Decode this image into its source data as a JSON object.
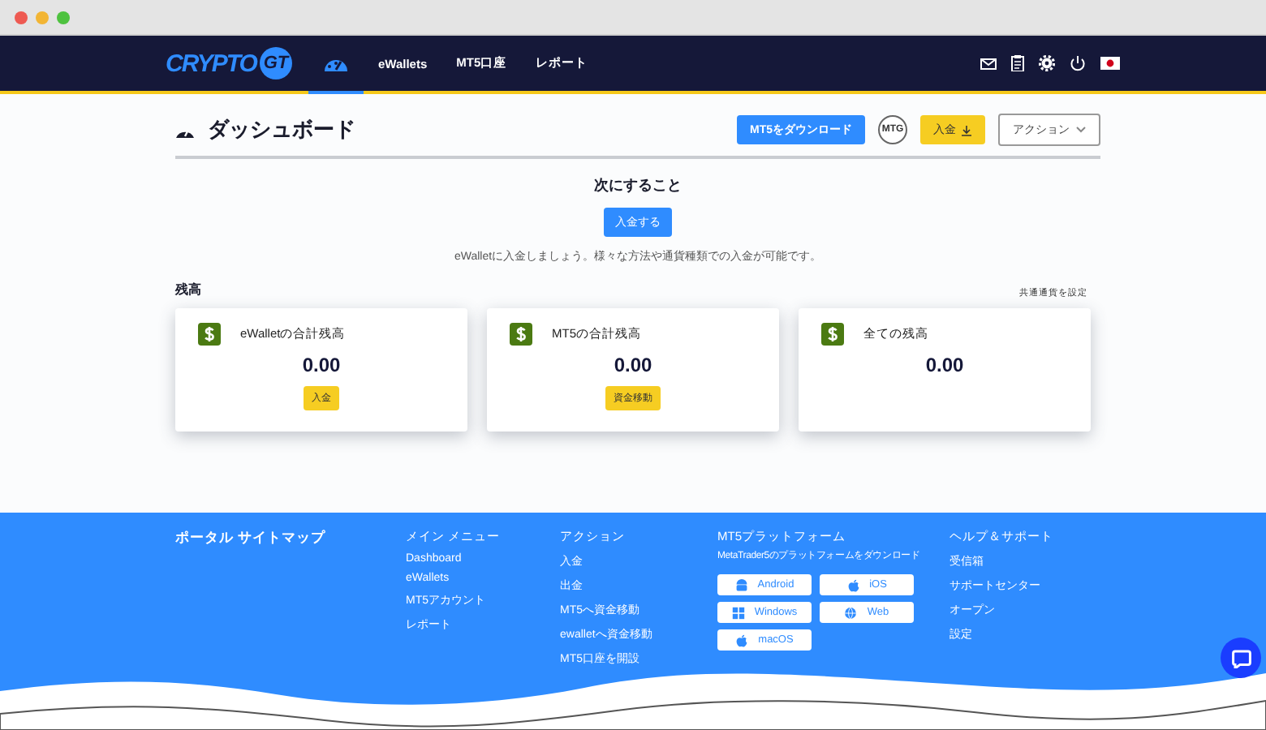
{
  "nav": {
    "logo": "CRYPTO",
    "logo_badge": "GT",
    "tabs": [
      {
        "kind": "icon",
        "selected": true
      },
      {
        "kind": "text",
        "label": "eWallets",
        "selected": false
      },
      {
        "kind": "text",
        "label": "MT5口座",
        "selected": false
      },
      {
        "kind": "text",
        "label": "レポート",
        "selected": false
      }
    ]
  },
  "header": {
    "title": "ダッシュボード",
    "download_button": "MT5をダウンロード",
    "avatar": "MTG",
    "deposit_button": "入金",
    "action_menu": "アクション"
  },
  "next_step": {
    "heading": "次にすること",
    "button": "入金する",
    "text": "eWalletに入金しましょう。様々な方法や通貨種類での入金が可能です。"
  },
  "balance": {
    "heading": "残高",
    "link": "共通通貨を設定",
    "cards": [
      {
        "label": "eWalletの合計残高",
        "amount": "0.00",
        "button": "入金"
      },
      {
        "label": "MT5の合計残高",
        "amount": "0.00",
        "button": "資金移動"
      },
      {
        "label": "全ての残高",
        "amount": "0.00"
      }
    ]
  },
  "footer": {
    "title": "ポータル サイトマップ",
    "columns": [
      {
        "heading": "メイン メニュー",
        "links": [
          "Dashboard",
          "eWallets",
          "MT5アカウント",
          "レポート"
        ]
      },
      {
        "heading": "アクション",
        "links": [
          "入金",
          "出金",
          "MT5へ資金移動",
          "ewalletへ資金移動",
          "MT5口座を開設"
        ]
      }
    ],
    "platform": {
      "heading": "MT5プラットフォーム",
      "subtitle": "MetaTrader5のプラットフォームをダウンロード",
      "buttons": [
        {
          "kind": "android",
          "label": "Android"
        },
        {
          "kind": "apple",
          "label": "iOS"
        },
        {
          "kind": "windows",
          "label": "Windows"
        },
        {
          "kind": "globe",
          "label": "Web"
        },
        {
          "kind": "apple",
          "label": "macOS"
        }
      ]
    },
    "help": {
      "heading": "ヘルプ＆サポート",
      "links": [
        "受信箱",
        "サポートセンター",
        "オープン",
        "設定"
      ]
    }
  }
}
